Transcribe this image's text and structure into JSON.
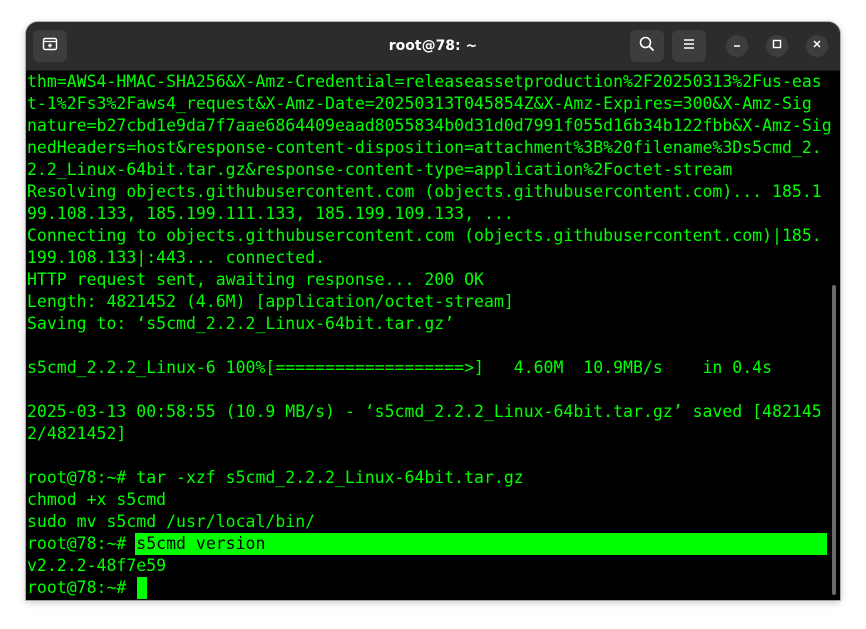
{
  "window": {
    "title": "root@78: ~"
  },
  "icons": {
    "new_tab": "new-tab-icon",
    "search": "search-icon",
    "menu": "hamburger-menu-icon",
    "minimize": "minimize-icon",
    "maximize": "maximize-icon",
    "close": "close-icon"
  },
  "colors": {
    "terminal_bg": "#000000",
    "terminal_fg": "#00ff00",
    "titlebar_bg": "#2c2c2c"
  },
  "terminal": {
    "lines": [
      "thm=AWS4-HMAC-SHA256&X-Amz-Credential=releaseassetproduction%2F20250313%2Fus-eas",
      "t-1%2Fs3%2Faws4_request&X-Amz-Date=20250313T045854Z&X-Amz-Expires=300&X-Amz-Sig",
      "nature=b27cbd1e9da7f7aae6864409eaad8055834b0d31d0d7991f055d16b34b122fbb&X-Amz-Sig",
      "nedHeaders=host&response-content-disposition=attachment%3B%20filename%3Ds5cmd_2.",
      "2.2_Linux-64bit.tar.gz&response-content-type=application%2Foctet-stream",
      "Resolving objects.githubusercontent.com (objects.githubusercontent.com)... 185.1",
      "99.108.133, 185.199.111.133, 185.199.109.133, ...",
      "Connecting to objects.githubusercontent.com (objects.githubusercontent.com)|185.",
      "199.108.133|:443... connected.",
      "HTTP request sent, awaiting response... 200 OK",
      "Length: 4821452 (4.6M) [application/octet-stream]",
      "Saving to: ‘s5cmd_2.2.2_Linux-64bit.tar.gz’",
      "",
      "s5cmd_2.2.2_Linux-6 100%[===================>]   4.60M  10.9MB/s    in 0.4s",
      "",
      "2025-03-13 00:58:55 (10.9 MB/s) - ‘s5cmd_2.2.2_Linux-64bit.tar.gz’ saved [482145",
      "2/4821452]",
      "",
      "root@78:~# tar -xzf s5cmd_2.2.2_Linux-64bit.tar.gz",
      "chmod +x s5cmd",
      "sudo mv s5cmd /usr/local/bin/"
    ],
    "prompt": "root@78:~# ",
    "selected_command": "s5cmd version",
    "version_output": "v2.2.2-48f7e59",
    "final_prompt": "root@78:~# "
  }
}
